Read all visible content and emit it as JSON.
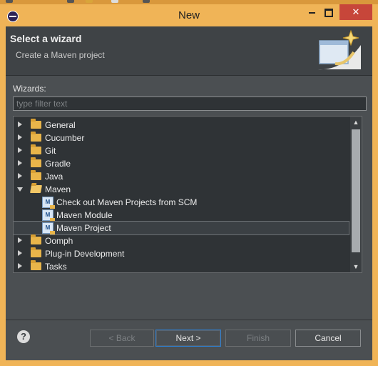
{
  "window": {
    "title": "New"
  },
  "header": {
    "title": "Select a wizard",
    "subtitle": "Create a Maven project"
  },
  "wizards_label": "Wizards:",
  "filter": {
    "placeholder": "type filter text",
    "value": ""
  },
  "tree": {
    "items": [
      {
        "label": "General",
        "expanded": false,
        "icon": "folder-icon"
      },
      {
        "label": "Cucumber",
        "expanded": false,
        "icon": "folder-icon"
      },
      {
        "label": "Git",
        "expanded": false,
        "icon": "folder-icon"
      },
      {
        "label": "Gradle",
        "expanded": false,
        "icon": "folder-icon"
      },
      {
        "label": "Java",
        "expanded": false,
        "icon": "folder-icon"
      },
      {
        "label": "Maven",
        "expanded": true,
        "icon": "folder-open-icon"
      },
      {
        "label": "Check out Maven Projects from SCM",
        "icon": "maven-checkout-icon"
      },
      {
        "label": "Maven Module",
        "icon": "maven-module-icon"
      },
      {
        "label": "Maven Project",
        "icon": "maven-project-icon",
        "selected": true
      },
      {
        "label": "Oomph",
        "expanded": false,
        "icon": "folder-icon"
      },
      {
        "label": "Plug-in Development",
        "expanded": false,
        "icon": "folder-icon"
      },
      {
        "label": "Tasks",
        "expanded": false,
        "icon": "folder-icon"
      }
    ]
  },
  "buttons": {
    "help": "?",
    "back": "< Back",
    "next": "Next >",
    "finish": "Finish",
    "cancel": "Cancel"
  },
  "colors": {
    "accent": "#2f7fd0",
    "window_frame": "#f0b457",
    "close_button": "#c7463a",
    "dialog_bg": "#4b4f52"
  }
}
